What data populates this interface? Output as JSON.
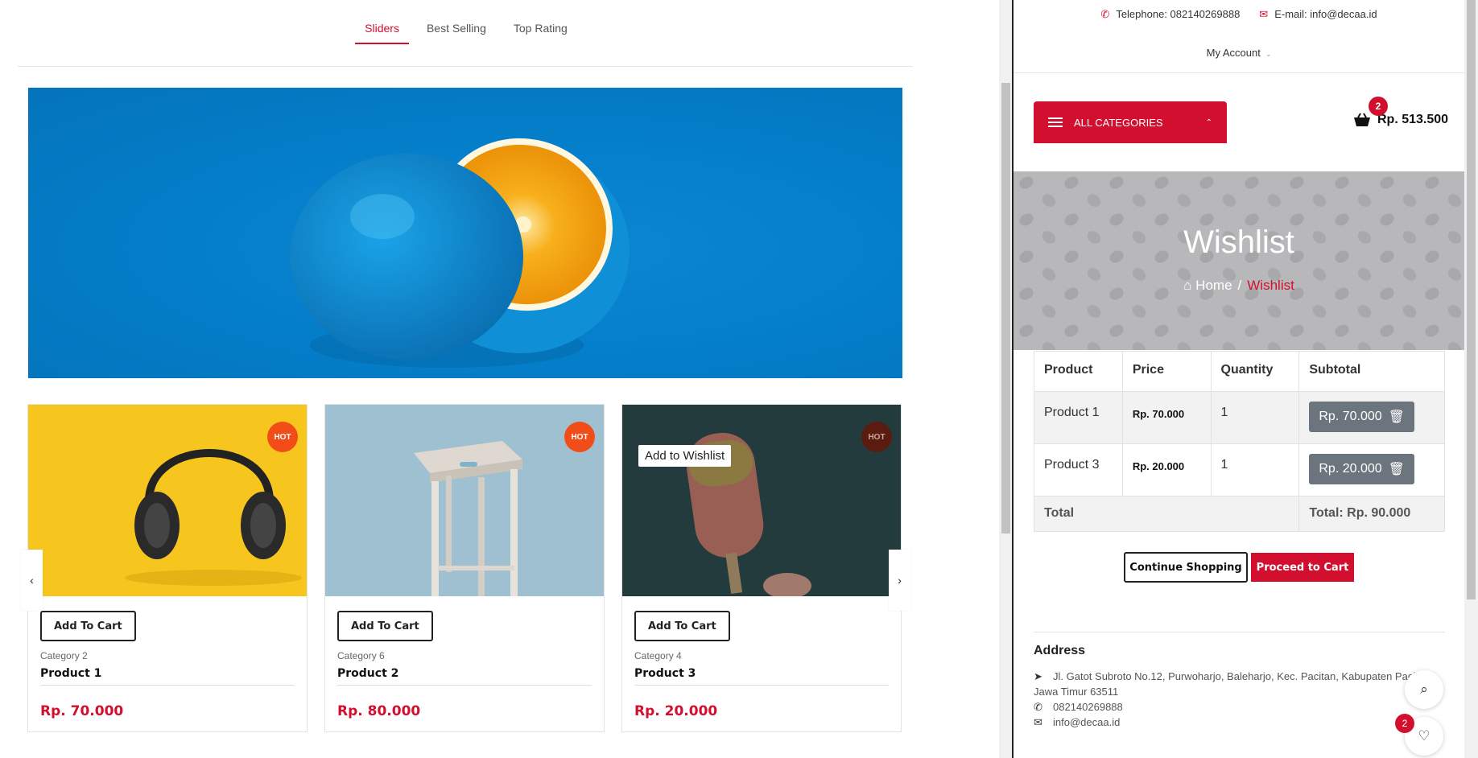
{
  "left": {
    "tabs": [
      {
        "label": "Sliders",
        "active": true
      },
      {
        "label": "Best Selling",
        "active": false
      },
      {
        "label": "Top Rating",
        "active": false
      }
    ],
    "hero_alt": "blue orange",
    "products": [
      {
        "badge": "HOT",
        "add_to_cart": "Add To Cart",
        "category": "Category 2",
        "name": "Product 1",
        "price": "Rp. 70.000"
      },
      {
        "badge": "HOT",
        "add_to_cart": "Add To Cart",
        "category": "Category 6",
        "name": "Product 2",
        "price": "Rp. 80.000"
      },
      {
        "badge": "HOT",
        "add_to_cart": "Add To Cart",
        "category": "Category 4",
        "name": "Product 3",
        "price": "Rp. 20.000",
        "tooltip": "Add to Wishlist"
      }
    ],
    "prev_arrow": "‹",
    "next_arrow": "›"
  },
  "right": {
    "telephone": "Telephone: 082140269888",
    "email": "E-mail: info@decaa.id",
    "account": "My Account",
    "all_categories": "ALL CATEGORIES",
    "cart_count": "2",
    "cart_total": "Rp. 513.500",
    "banner_title": "Wishlist",
    "breadcrumb": {
      "home": "Home",
      "separator": "/",
      "current": "Wishlist"
    },
    "table": {
      "headers": [
        "Product",
        "Price",
        "Quantity",
        "Subtotal"
      ],
      "rows": [
        {
          "product": "Product 1",
          "price": "Rp. 70.000",
          "qty": "1",
          "subtotal": "Rp. 70.000"
        },
        {
          "product": "Product 3",
          "price": "Rp. 20.000",
          "qty": "1",
          "subtotal": "Rp. 20.000"
        }
      ],
      "total_label": "Total",
      "total_value": "Total: Rp. 90.000"
    },
    "continue_shopping": "Continue Shopping",
    "proceed_to_cart": "Proceed to Cart",
    "address": {
      "heading": "Address",
      "street": "Jl. Gatot Subroto No.12, Purwoharjo, Baleharjo, Kec. Pacitan, Kabupaten Pacitan, Jawa Timur 63511",
      "phone": "082140269888",
      "email": "info@decaa.id"
    },
    "wishlist_count": "2"
  },
  "colors": {
    "accent": "#d20f2e",
    "hot_badge": "#f24d18",
    "subtotal_button": "#6c757d",
    "hero_blue": "#057fcb"
  }
}
